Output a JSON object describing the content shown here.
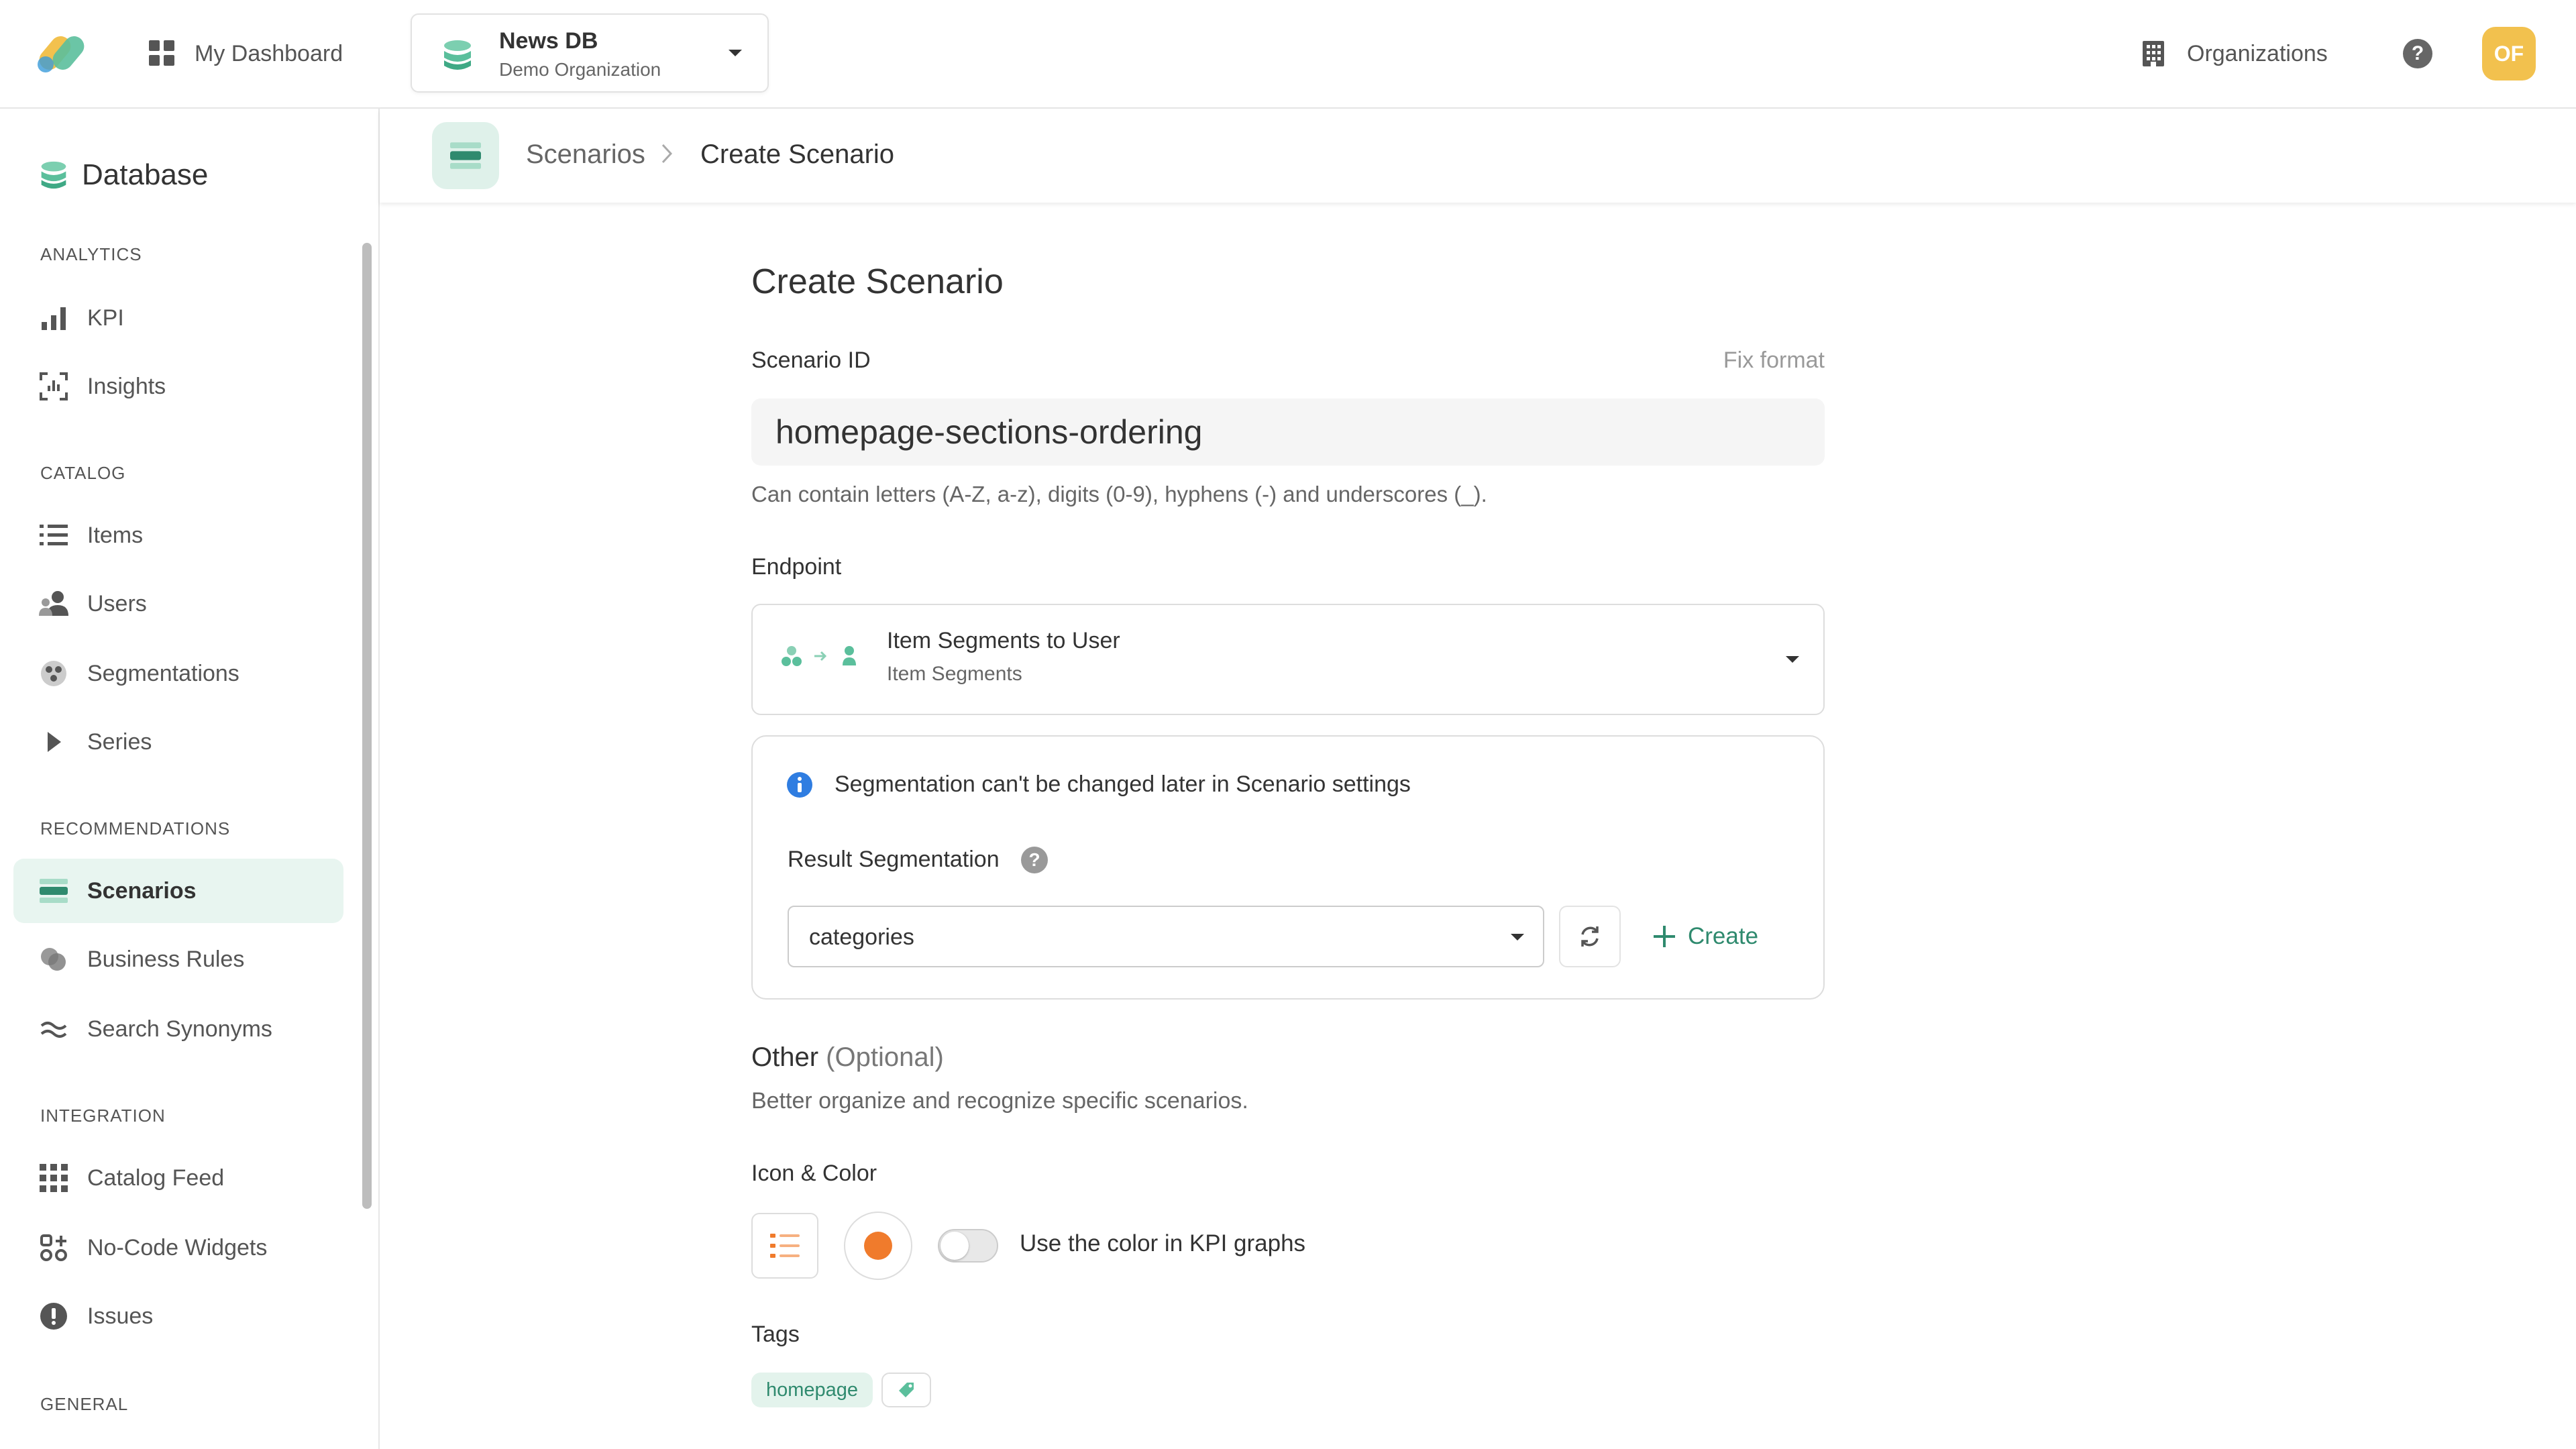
{
  "topbar": {
    "dashboard_label": "My Dashboard",
    "db_name": "News DB",
    "db_org": "Demo Organization",
    "organizations_label": "Organizations",
    "help_glyph": "?",
    "avatar_initials": "OF"
  },
  "sidebar": {
    "header": "Database",
    "sections": {
      "analytics": "ANALYTICS",
      "catalog": "CATALOG",
      "recommendations": "RECOMMENDATIONS",
      "integration": "INTEGRATION",
      "general": "GENERAL"
    },
    "items": [
      {
        "label": "KPI",
        "icon": "bar-chart-icon"
      },
      {
        "label": "Insights",
        "icon": "insights-icon"
      },
      {
        "label": "Items",
        "icon": "list-icon"
      },
      {
        "label": "Users",
        "icon": "users-icon"
      },
      {
        "label": "Segmentations",
        "icon": "segmentations-icon"
      },
      {
        "label": "Series",
        "icon": "play-icon"
      },
      {
        "label": "Scenarios",
        "icon": "scenarios-icon",
        "active": true
      },
      {
        "label": "Business Rules",
        "icon": "business-rules-icon"
      },
      {
        "label": "Search Synonyms",
        "icon": "approx-icon"
      },
      {
        "label": "Catalog Feed",
        "icon": "grid-icon"
      },
      {
        "label": "No-Code Widgets",
        "icon": "widgets-icon"
      },
      {
        "label": "Issues",
        "icon": "alert-icon"
      }
    ]
  },
  "breadcrumb": {
    "parent": "Scenarios",
    "current": "Create Scenario"
  },
  "form": {
    "title": "Create Scenario",
    "scenario_id_label": "Scenario ID",
    "fix_format": "Fix format",
    "scenario_id_value": "homepage-sections-ordering",
    "scenario_id_help": "Can contain letters (A-Z, a-z), digits (0-9), hyphens (-) and underscores (_).",
    "endpoint_label": "Endpoint",
    "endpoint_title": "Item Segments to User",
    "endpoint_subtitle": "Item Segments",
    "info_bold": "Segmentation can't be changed later",
    "info_rest": " in Scenario settings",
    "result_seg_label": "Result Segmentation",
    "result_seg_value": "categories",
    "create_label": "Create",
    "other_title": "Other",
    "other_optional": "(Optional)",
    "other_desc": "Better organize and recognize specific scenarios.",
    "icon_color_label": "Icon & Color",
    "selected_color": "#f07b2c",
    "toggle_label": "Use the color in KPI graphs",
    "toggle_on": false,
    "tags_label": "Tags",
    "tags": [
      "homepage"
    ]
  },
  "colors": {
    "accent": "#2f8a6e",
    "accent_light": "#e8f5f0",
    "avatar": "#f2c14e",
    "info": "#2f7de1"
  }
}
